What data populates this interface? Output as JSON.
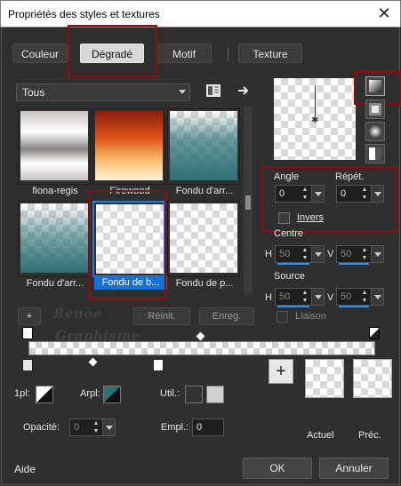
{
  "window": {
    "title": "Propriétés des styles et textures",
    "close_glyph": "✕"
  },
  "tabs": [
    {
      "label": "Couleur"
    },
    {
      "label": "Dégradé"
    },
    {
      "label": "Motif"
    },
    {
      "label": "Texture"
    }
  ],
  "filter": {
    "value": "Tous"
  },
  "gradients": [
    {
      "label": "fiona-regis"
    },
    {
      "label": "Firewood"
    },
    {
      "label": "Fondu d'arr..."
    },
    {
      "label": "Fondu d'arr..."
    },
    {
      "label": "Fondu de b..."
    },
    {
      "label": "Fondu de p..."
    }
  ],
  "controls": {
    "angle_label": "Angle",
    "repeat_label": "Répét.",
    "angle_value": "0",
    "repeat_value": "0",
    "invert_label": "Invers",
    "center_label": "Centre",
    "center_h_label": "H",
    "center_h": "50",
    "center_v_label": "V",
    "center_v": "50",
    "source_label": "Source",
    "source_h_label": "H",
    "source_h": "50",
    "source_v_label": "V",
    "source_v": "50",
    "link_label": "Liaison"
  },
  "gradient_editor": {
    "add_label": "+",
    "reset_label": "Réinit.",
    "save_label": "Enreg."
  },
  "stop": {
    "first_label": "1pl:",
    "arpl_label": "Arpl:",
    "util_label": "Util.:",
    "opacity_label": "Opacité:",
    "opacity_value": "0",
    "empl_label": "Empl.:",
    "empl_value": "0"
  },
  "swatches": {
    "add_label": "+",
    "current_label": "Actuel",
    "previous_label": "Préc."
  },
  "footer": {
    "help_label": "Aide",
    "ok_label": "OK",
    "cancel_label": "Annuler"
  },
  "watermark": {
    "line1": "Renée",
    "line2": "Graphisme"
  },
  "colors": {
    "accent": "#1a6fd4",
    "highlight": "#8a0f12"
  }
}
